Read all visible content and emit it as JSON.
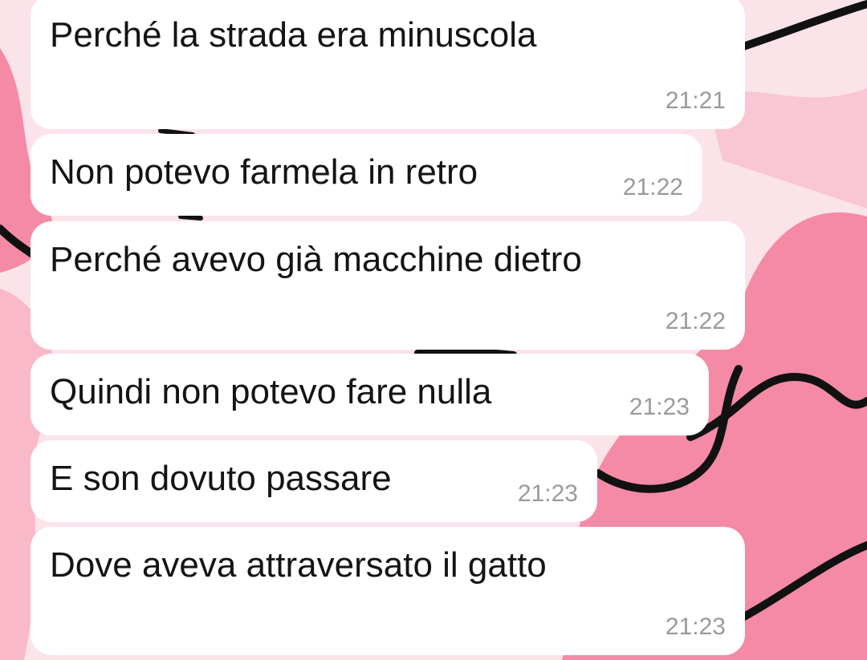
{
  "chat": {
    "messages": [
      {
        "text": "Perché la strada era minuscola",
        "time": "21:21"
      },
      {
        "text": "Non potevo farmela in retro",
        "time": "21:22"
      },
      {
        "text": "Perché avevo già macchine dietro",
        "time": "21:22"
      },
      {
        "text": "Quindi non potevo fare nulla",
        "time": "21:23"
      },
      {
        "text": "E son dovuto passare",
        "time": "21:23"
      },
      {
        "text": "Dove aveva attraversato il gatto",
        "time": "21:23"
      }
    ]
  },
  "theme": {
    "wallpaper_bg": "#fbe3ea",
    "wallpaper_blob": "#f58aa6",
    "wallpaper_blob_light": "#f9b9c9",
    "wallpaper_line": "#111111",
    "bubble_bg": "#ffffff",
    "text_color": "#141414",
    "time_color": "#9a9a9a"
  }
}
